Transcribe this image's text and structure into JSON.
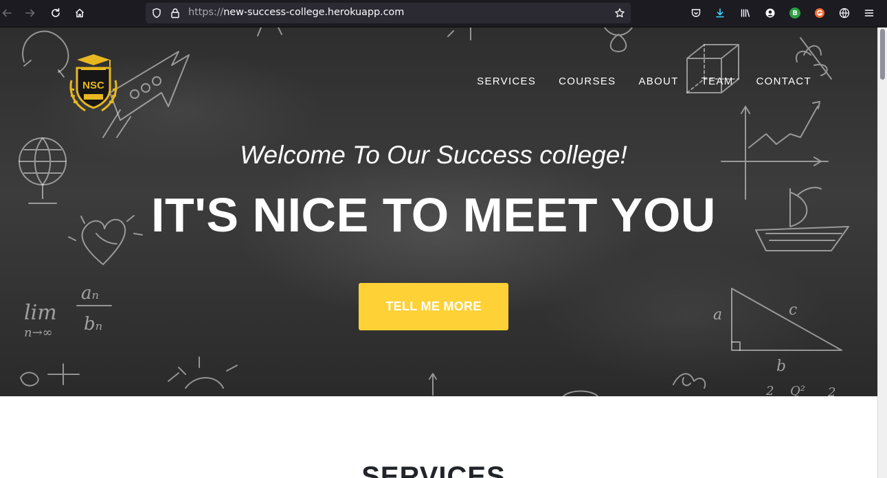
{
  "browser": {
    "url_protocol": "https://",
    "url_host": "new-success-college.herokuapp.com",
    "profile_badge": "B"
  },
  "header": {
    "logo_text": "NSC",
    "nav": [
      {
        "label": "SERVICES"
      },
      {
        "label": "COURSES"
      },
      {
        "label": "ABOUT"
      },
      {
        "label": "TEAM"
      },
      {
        "label": "CONTACT"
      }
    ]
  },
  "hero": {
    "subheading": "Welcome To Our Success college!",
    "heading": "IT'S NICE TO MEET YOU",
    "cta_label": "TELL ME MORE"
  },
  "sections": {
    "services_title": "SERVICES"
  },
  "colors": {
    "accent": "#fed136",
    "chrome_bg": "#1c1b22",
    "urlbar_bg": "#2b2a33"
  },
  "chalk_text": {
    "lim": "lim",
    "n_to_inf": "n→∞",
    "a_n": "aₙ",
    "b_n": "bₙ",
    "tri_a": "a",
    "tri_b": "b",
    "tri_c": "c",
    "sq": "2",
    "q2": "Q²",
    "sq2": "2"
  }
}
